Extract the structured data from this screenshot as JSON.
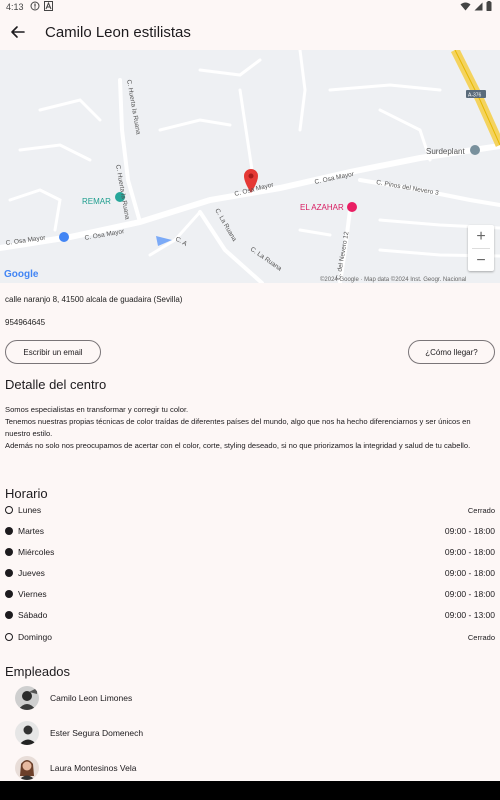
{
  "status": {
    "time": "4:13"
  },
  "app_bar": {
    "title": "Camilo Leon estilistas"
  },
  "map": {
    "street_labels": [
      "C. Osa Mayor",
      "C. Osa Mayor",
      "C. Osa Mayor",
      "C. Osa Mayor",
      "C. Huerta la Ruana",
      "C. Huerta la Ruana",
      "C. La Ruana",
      "C. La Ruana",
      "C. Pinos del Nevero 3",
      "C. del Nevero 12",
      "C. A"
    ],
    "places": {
      "remar": "REMAR",
      "el_azahar": "EL AZAHAR",
      "surdeplant": "Surdeplant",
      "highway": "A-376"
    },
    "attribution": "©2024 Google · Map data ©2024 Inst. Geogr. Nacional",
    "google_logo": "Google"
  },
  "business": {
    "address": "calle naranjo 8, 41500 alcala de guadaira (Sevilla)",
    "phone": "954964645",
    "email_button": "Escribir un email",
    "directions_button": "¿Cómo llegar?"
  },
  "detail": {
    "heading": "Detalle del centro",
    "lines": [
      "Somos especialistas en transformar y corregir tu color.",
      "Tenemos nuestras propias técnicas de color traídas de diferentes países del mundo, algo que nos ha hecho diferenciarnos y ser únicos en nuestro estilo.",
      "Además no solo nos preocupamos de acertar con el color, corte, styling deseado, si no que priorizamos la integridad y salud de tu cabello."
    ]
  },
  "schedule": {
    "heading": "Horario",
    "days": [
      {
        "day": "Lunes",
        "hours": "Cerrado",
        "open": false
      },
      {
        "day": "Martes",
        "hours": "09:00 - 18:00",
        "open": true
      },
      {
        "day": "Miércoles",
        "hours": "09:00 - 18:00",
        "open": true
      },
      {
        "day": "Jueves",
        "hours": "09:00 - 18:00",
        "open": true
      },
      {
        "day": "Viernes",
        "hours": "09:00 - 18:00",
        "open": true
      },
      {
        "day": "Sábado",
        "hours": "09:00 - 13:00",
        "open": true
      },
      {
        "day": "Domingo",
        "hours": "Cerrado",
        "open": false
      }
    ]
  },
  "employees": {
    "heading": "Empleados",
    "list": [
      {
        "name": "Camilo Leon Limones"
      },
      {
        "name": "Ester Segura Domenech"
      },
      {
        "name": "Laura Montesinos Vela"
      }
    ]
  },
  "colors": {
    "background": "#fdf7f6",
    "map_pin": "#e53935",
    "text": "#1d1b1e"
  }
}
